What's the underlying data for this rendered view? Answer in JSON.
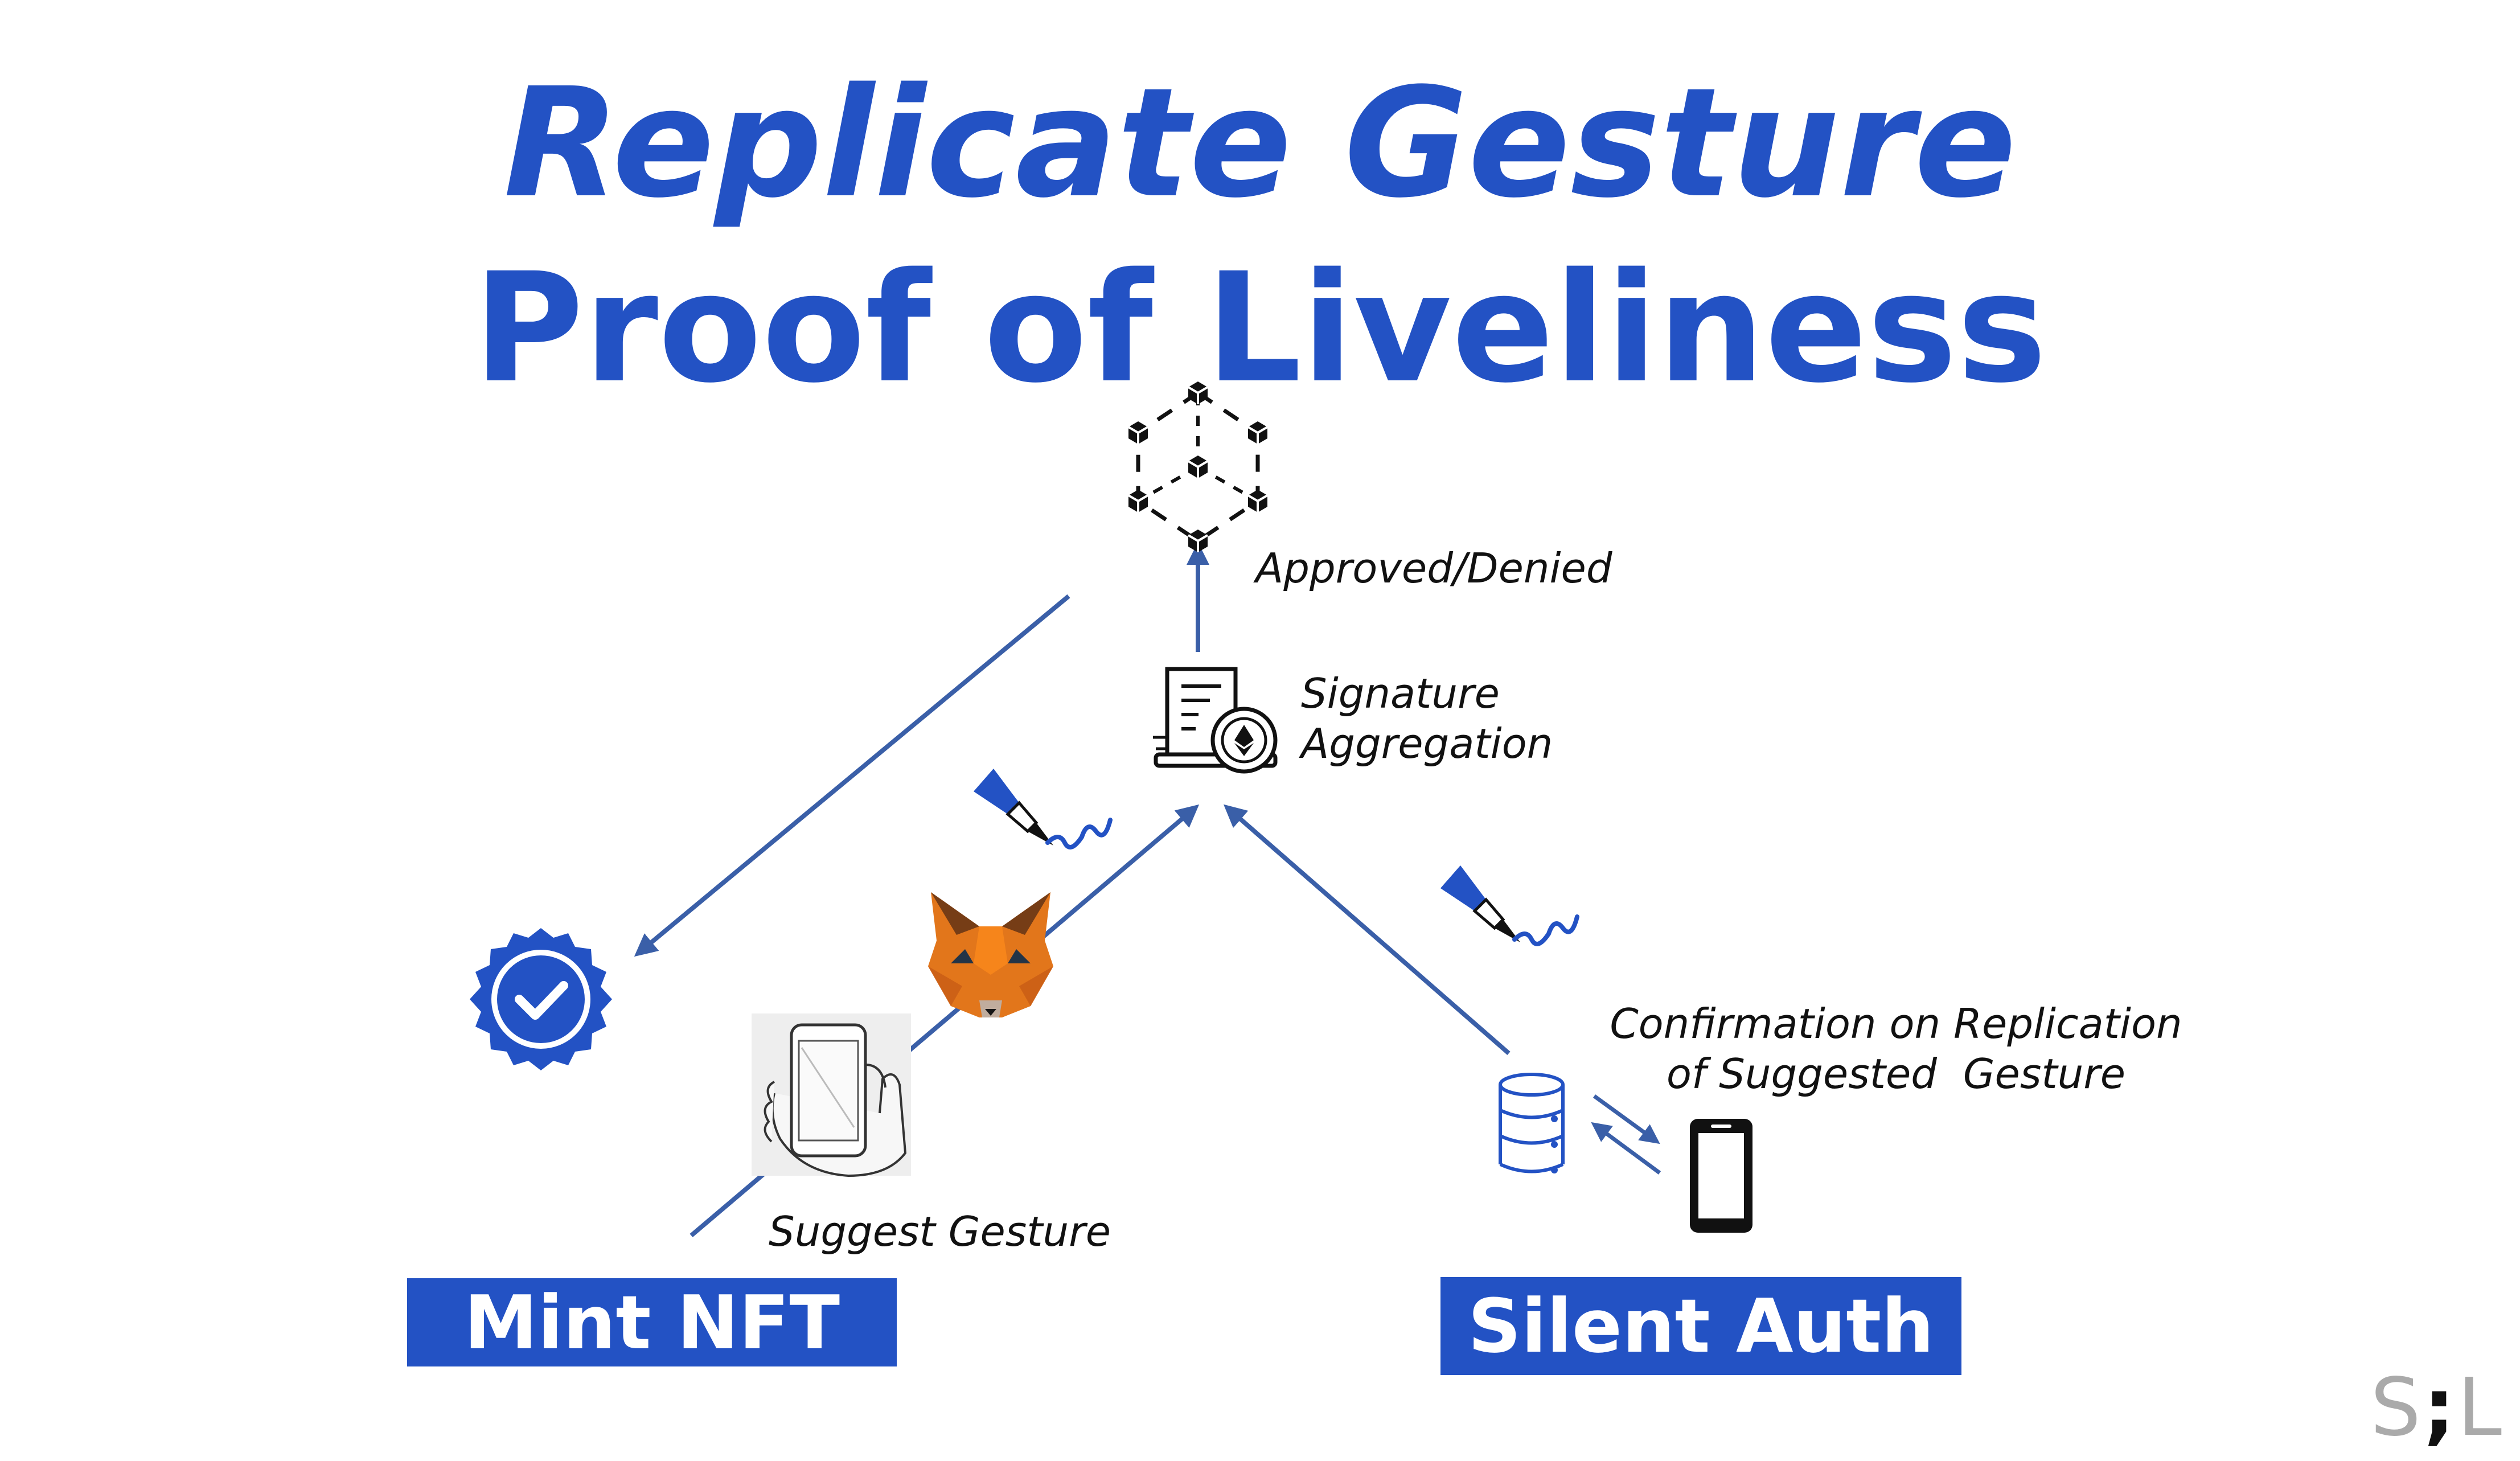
{
  "title": {
    "line1": "Replicate Gesture",
    "line2": "Proof of Liveliness"
  },
  "labels": {
    "approved": "Approved/Denied",
    "signature_aggregation": [
      "Signature",
      "Aggregation"
    ],
    "confirmation": [
      "Confirmation on Replication",
      "of Suggested  Gesture"
    ],
    "suggest": "Suggest Gesture"
  },
  "boxes": {
    "mint": "Mint NFT",
    "silent": "Silent Auth"
  },
  "logo": {
    "left": "S",
    "mid": ";",
    "right": "L"
  },
  "colors": {
    "primary": "#2352c4",
    "arrow": "#3a5fa8",
    "fox_orange": "#e2761b"
  },
  "icons": [
    "blockchain-icon",
    "signature-aggregation-icon",
    "verified-badge-icon",
    "metamask-fox-icon",
    "hand-phone-icon",
    "fountain-pen-signature-icon",
    "database-icon",
    "smartphone-icon"
  ]
}
